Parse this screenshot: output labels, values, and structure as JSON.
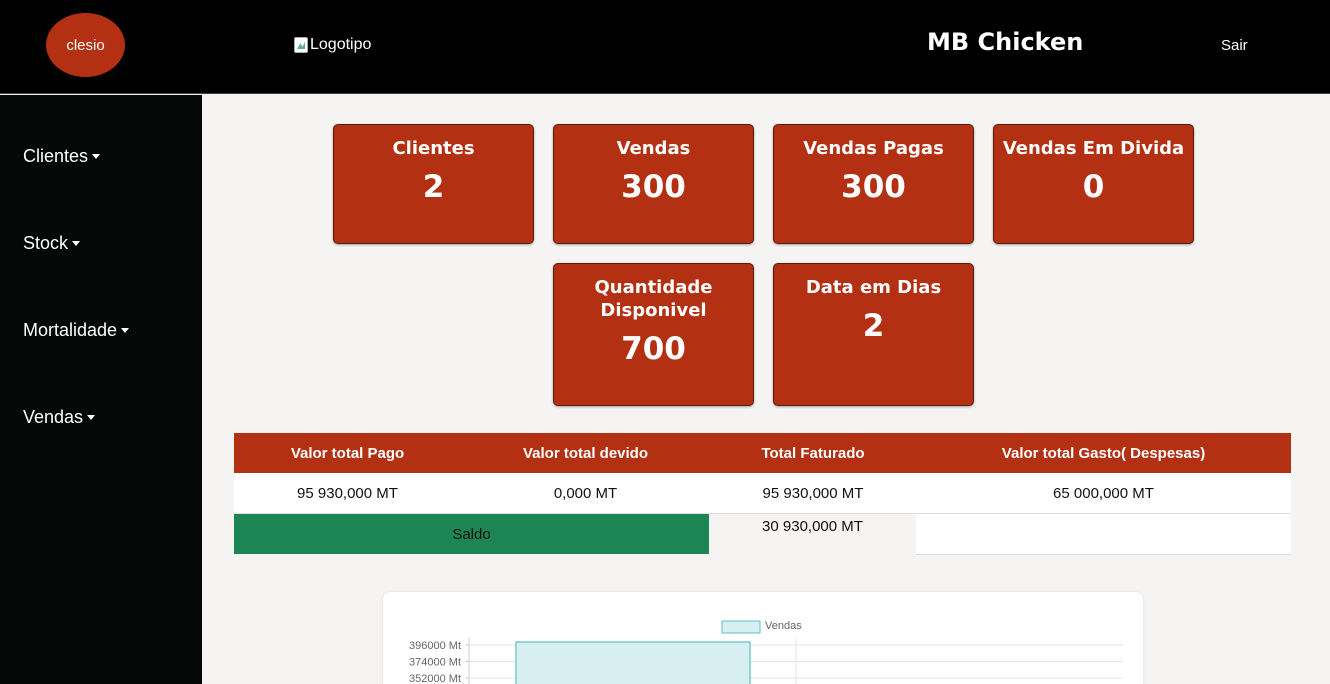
{
  "header": {
    "user_name": "clesio",
    "logo_alt": "Logotipo",
    "brand": "MB Chicken",
    "logout_label": "Sair"
  },
  "sidebar": {
    "items": [
      {
        "label": "Clientes"
      },
      {
        "label": "Stock"
      },
      {
        "label": "Mortalidade"
      },
      {
        "label": "Vendas"
      }
    ]
  },
  "cards": [
    {
      "label": "Clientes",
      "value": "2"
    },
    {
      "label": "Vendas",
      "value": "300"
    },
    {
      "label": "Vendas Pagas",
      "value": "300"
    },
    {
      "label": "Vendas Em Divida",
      "value": "0"
    },
    {
      "label": "Quantidade Disponivel",
      "value": "700"
    },
    {
      "label": "Data em Dias",
      "value": "2"
    }
  ],
  "summary": {
    "headers": [
      "Valor total Pago",
      "Valor total devido",
      "Total Faturado",
      "Valor total Gasto( Despesas)"
    ],
    "values": [
      "95 930,000 MT",
      "0,000 MT",
      "95 930,000 MT",
      "65 000,000 MT"
    ],
    "saldo_label": "Saldo",
    "saldo_value": "30 930,000 MT"
  },
  "colors": {
    "accent": "#b43012",
    "saldo": "#1c8553",
    "bar_fill": "#d7eff0",
    "bar_stroke": "#5bc0c0"
  },
  "chart_data": {
    "type": "bar",
    "series": [
      {
        "name": "Vendas",
        "values": [
          400000
        ]
      }
    ],
    "ytick_labels": [
      "396000 Mt",
      "374000 Mt",
      "352000 Mt"
    ],
    "yticks": [
      396000,
      374000,
      352000
    ]
  }
}
